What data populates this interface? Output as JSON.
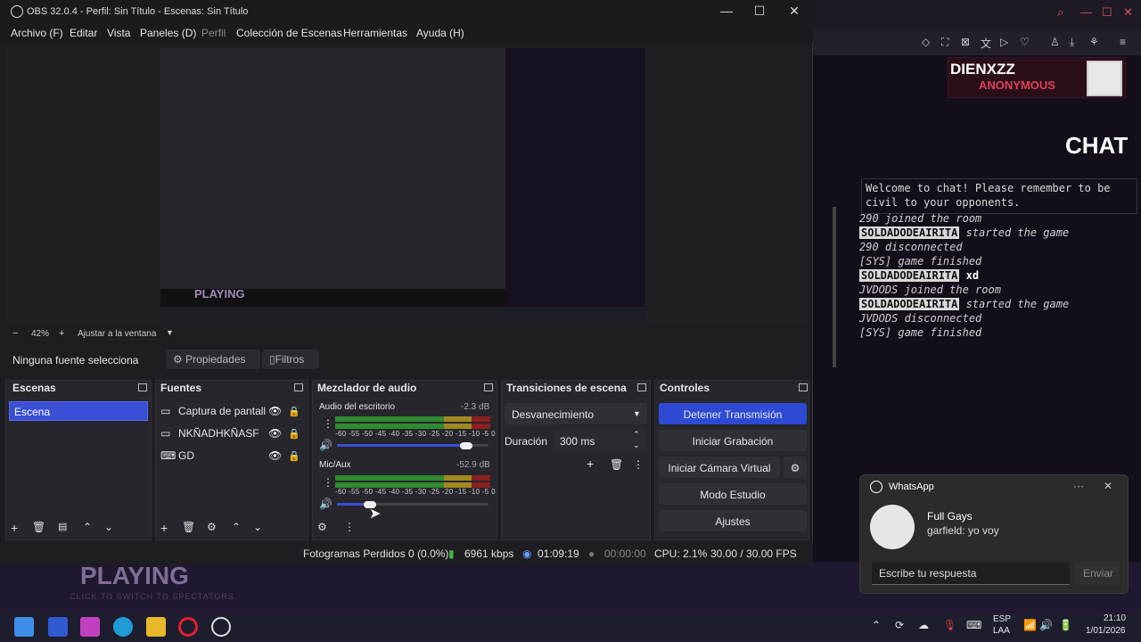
{
  "window": {
    "title": "OBS 32.0.4 - Perfil: Sin Título - Escenas: Sin Título"
  },
  "menu": [
    "Archivo (F)",
    "Editar",
    "Vista",
    "Paneles (D)",
    "Perfil",
    "Colección de Escenas",
    "Herramientas",
    "Ayuda (H)"
  ],
  "zoom": {
    "minus": "−",
    "value": "42%",
    "plus": "+",
    "fit": "Ajustar a la ventana"
  },
  "sourcebar": {
    "none": "Ninguna fuente selecciona",
    "props": "Propiedades",
    "filters": "Filtros"
  },
  "docks": {
    "scenes": {
      "title": "Escenas",
      "items": [
        "Escena"
      ]
    },
    "sources": {
      "title": "Fuentes",
      "items": [
        "Captura de pantall:",
        "NKÑADHKÑASF",
        "GD"
      ]
    },
    "mixer": {
      "title": "Mezclador de audio",
      "channels": [
        {
          "name": "Audio del escritorio",
          "db": "-2.3 dB",
          "volume": 0.85
        },
        {
          "name": "Mic/Aux",
          "db": "-52.9 dB",
          "volume": 0.22
        }
      ],
      "scale": "-60 -55 -50 -45 -40 -35 -30 -25 -20 -15 -10 -5 0"
    },
    "transitions": {
      "title": "Transiciones de escena",
      "type": "Desvanecimiento",
      "duration_label": "Duración",
      "duration": "300 ms"
    },
    "controls": {
      "title": "Controles",
      "buttons": [
        "Detener Transmisión",
        "Iniciar Grabación",
        "Iniciar Cámara Virtual",
        "Modo Estudio",
        "Ajustes"
      ]
    }
  },
  "status": {
    "dropped": "Fotogramas Perdidos 0 (0.0%)",
    "bitrate": "6961 kbps",
    "live_time": "01:09:19",
    "rec_time": "00:00:00",
    "cpu": "CPU: 2.1%",
    "fps": "30.00 / 30.00 FPS"
  },
  "stream": {
    "player": "DIENXZZ",
    "tag": "ANONYMOUS",
    "chat_title": "CHAT",
    "welcome": "Welcome to chat! Please remember to be civil to your opponents.",
    "lines": [
      {
        "name": "290",
        "text": "joined the room",
        "boxed": false
      },
      {
        "name": "SOLDADODEAIRITA",
        "text": "started the game",
        "boxed": true
      },
      {
        "name": "290",
        "text": "disconnected",
        "boxed": false
      },
      {
        "name": "[SYS]",
        "text": "game finished",
        "boxed": false
      },
      {
        "name": "SOLDADODEAIRITA",
        "text": "xd",
        "boxed": true,
        "msg": true
      },
      {
        "name": "JVDODS",
        "text": "joined the room",
        "boxed": false
      },
      {
        "name": "SOLDADODEAIRITA",
        "text": "started the game",
        "boxed": true
      },
      {
        "name": "JVDODS",
        "text": "disconnected",
        "boxed": false
      },
      {
        "name": "[SYS]",
        "text": "game finished",
        "boxed": false
      }
    ],
    "playing": "PLAYING",
    "playing_sub": "CLICK TO SWITCH TO SPECTATORS"
  },
  "whatsapp": {
    "app": "WhatsApp",
    "sender": "Full Gays",
    "message": "garfield: yo voy",
    "placeholder": "Escribe tu respuesta",
    "send": "Enviar"
  },
  "taskbar": {
    "lang1": "ESP",
    "lang2": "LAA",
    "time": "21:10",
    "date": "1/01/2026"
  },
  "colors": {
    "accent": "#2e4ad4",
    "meter_green": "#2f8a30",
    "meter_yellow": "#a08a20",
    "meter_red": "#8a2020"
  }
}
